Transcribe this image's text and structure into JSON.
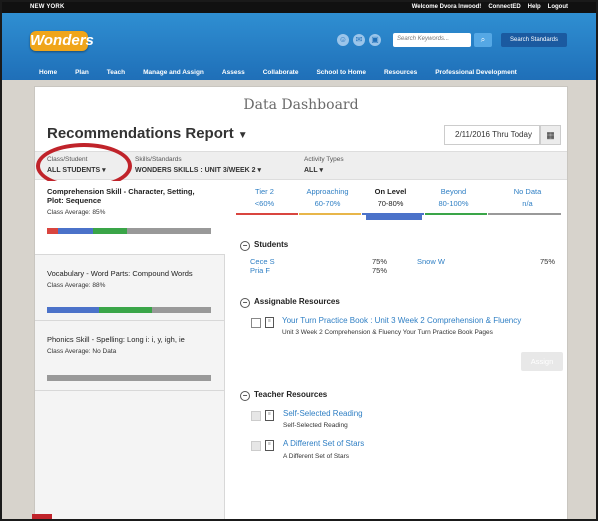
{
  "topbar": {
    "location": "NEW YORK",
    "welcome": "Welcome Dvora Inwood!",
    "connected": "ConnectED",
    "help": "Help",
    "logout": "Logout"
  },
  "header": {
    "logo": "Wonders",
    "search_placeholder": "Search Keywords...",
    "search_standards": "Search Standards"
  },
  "nav": [
    "Home",
    "Plan",
    "Teach",
    "Manage and Assign",
    "Assess",
    "Collaborate",
    "School to Home",
    "Resources",
    "Professional Development"
  ],
  "page": {
    "title": "Data Dashboard",
    "report": "Recommendations Report",
    "date_range": "2/11/2016 Thru Today"
  },
  "filters": {
    "class_label": "Class/Student",
    "class_value": "ALL STUDENTS",
    "skills_label": "Skills/Standards",
    "skills_value": "WONDERS SKILLS : UNIT 3/WEEK 2",
    "activity_label": "Activity Types",
    "activity_value": "ALL"
  },
  "skills": [
    {
      "name": "Comprehension Skill - Character, Setting, Plot: Sequence",
      "average": "Class Average: 85%",
      "distribution": [
        0.07,
        0.21,
        0.21,
        0.51
      ]
    },
    {
      "name": "Vocabulary - Word Parts: Compound Words",
      "average": "Class Average: 88%",
      "distribution": [
        0.32,
        0.32,
        0.36
      ]
    },
    {
      "name": "Phonics Skill - Spelling: Long i: i, y, igh, ie",
      "average": "Class Average: No Data",
      "distribution": [
        1.0
      ]
    }
  ],
  "tiers": [
    {
      "name": "Tier 2",
      "range": "<60%",
      "color": "#d9453f"
    },
    {
      "name": "Approaching",
      "range": "60-70%",
      "color": "#e8b64a"
    },
    {
      "name": "On Level",
      "range": "70-80%",
      "color": "#4b72c9"
    },
    {
      "name": "Beyond",
      "range": "80-100%",
      "color": "#3aa548"
    },
    {
      "name": "No Data",
      "range": "n/a",
      "color": "#999999"
    }
  ],
  "students_section": {
    "title": "Students",
    "rows": [
      {
        "name": "Cece S",
        "score": "75%"
      },
      {
        "name": "Pria F",
        "score": "75%"
      },
      {
        "name": "Snow W",
        "score": "75%"
      }
    ]
  },
  "assignable": {
    "title": "Assignable Resources",
    "items": [
      {
        "title": "Your Turn Practice Book : Unit 3 Week 2 Comprehension & Fluency",
        "subtitle": "Unit 3 Week 2 Comprehension & Fluency Your Turn Practice Book Pages"
      }
    ],
    "assign_label": "Assign"
  },
  "teacher": {
    "title": "Teacher Resources",
    "items": [
      {
        "title": "Self-Selected Reading",
        "subtitle": "Self-Selected Reading"
      },
      {
        "title": "A Different Set of Stars",
        "subtitle": "A Different Set of Stars"
      }
    ]
  },
  "colors": {
    "brand_blue": "#1f6fb8",
    "link_blue": "#2f7fc4",
    "highlight_ring": "#c0232a",
    "logo_orange": "#f0a51a"
  }
}
